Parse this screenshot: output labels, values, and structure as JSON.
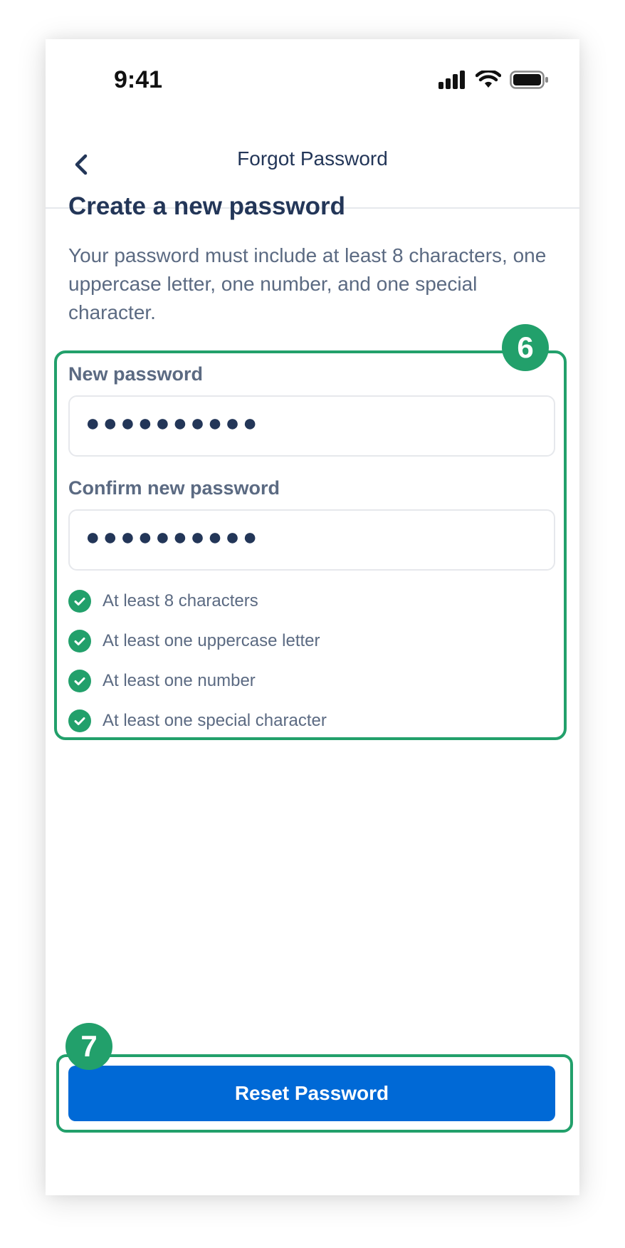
{
  "status_bar": {
    "time": "9:41"
  },
  "nav": {
    "title": "Forgot Password"
  },
  "content": {
    "heading": "Create a new password",
    "description": "Your password must include at least 8 characters, one uppercase letter, one number, and one special character."
  },
  "form": {
    "new_password": {
      "label": "New password",
      "value_masked": "●●●●●●●●●●"
    },
    "confirm_password": {
      "label": "Confirm new password",
      "value_masked": "●●●●●●●●●●"
    },
    "requirements": [
      {
        "label": "At least 8 characters",
        "met": true
      },
      {
        "label": "At least one uppercase letter",
        "met": true
      },
      {
        "label": "At least one number",
        "met": true
      },
      {
        "label": "At least one special character",
        "met": true
      }
    ]
  },
  "actions": {
    "reset_label": "Reset Password"
  },
  "annotations": {
    "form_badge": "6",
    "button_badge": "7"
  },
  "colors": {
    "accent": "#22a06b",
    "primary": "#0069d6",
    "text": "#233658"
  },
  "icons": {
    "back": "chevron-left-icon",
    "check": "check-circle-icon"
  }
}
